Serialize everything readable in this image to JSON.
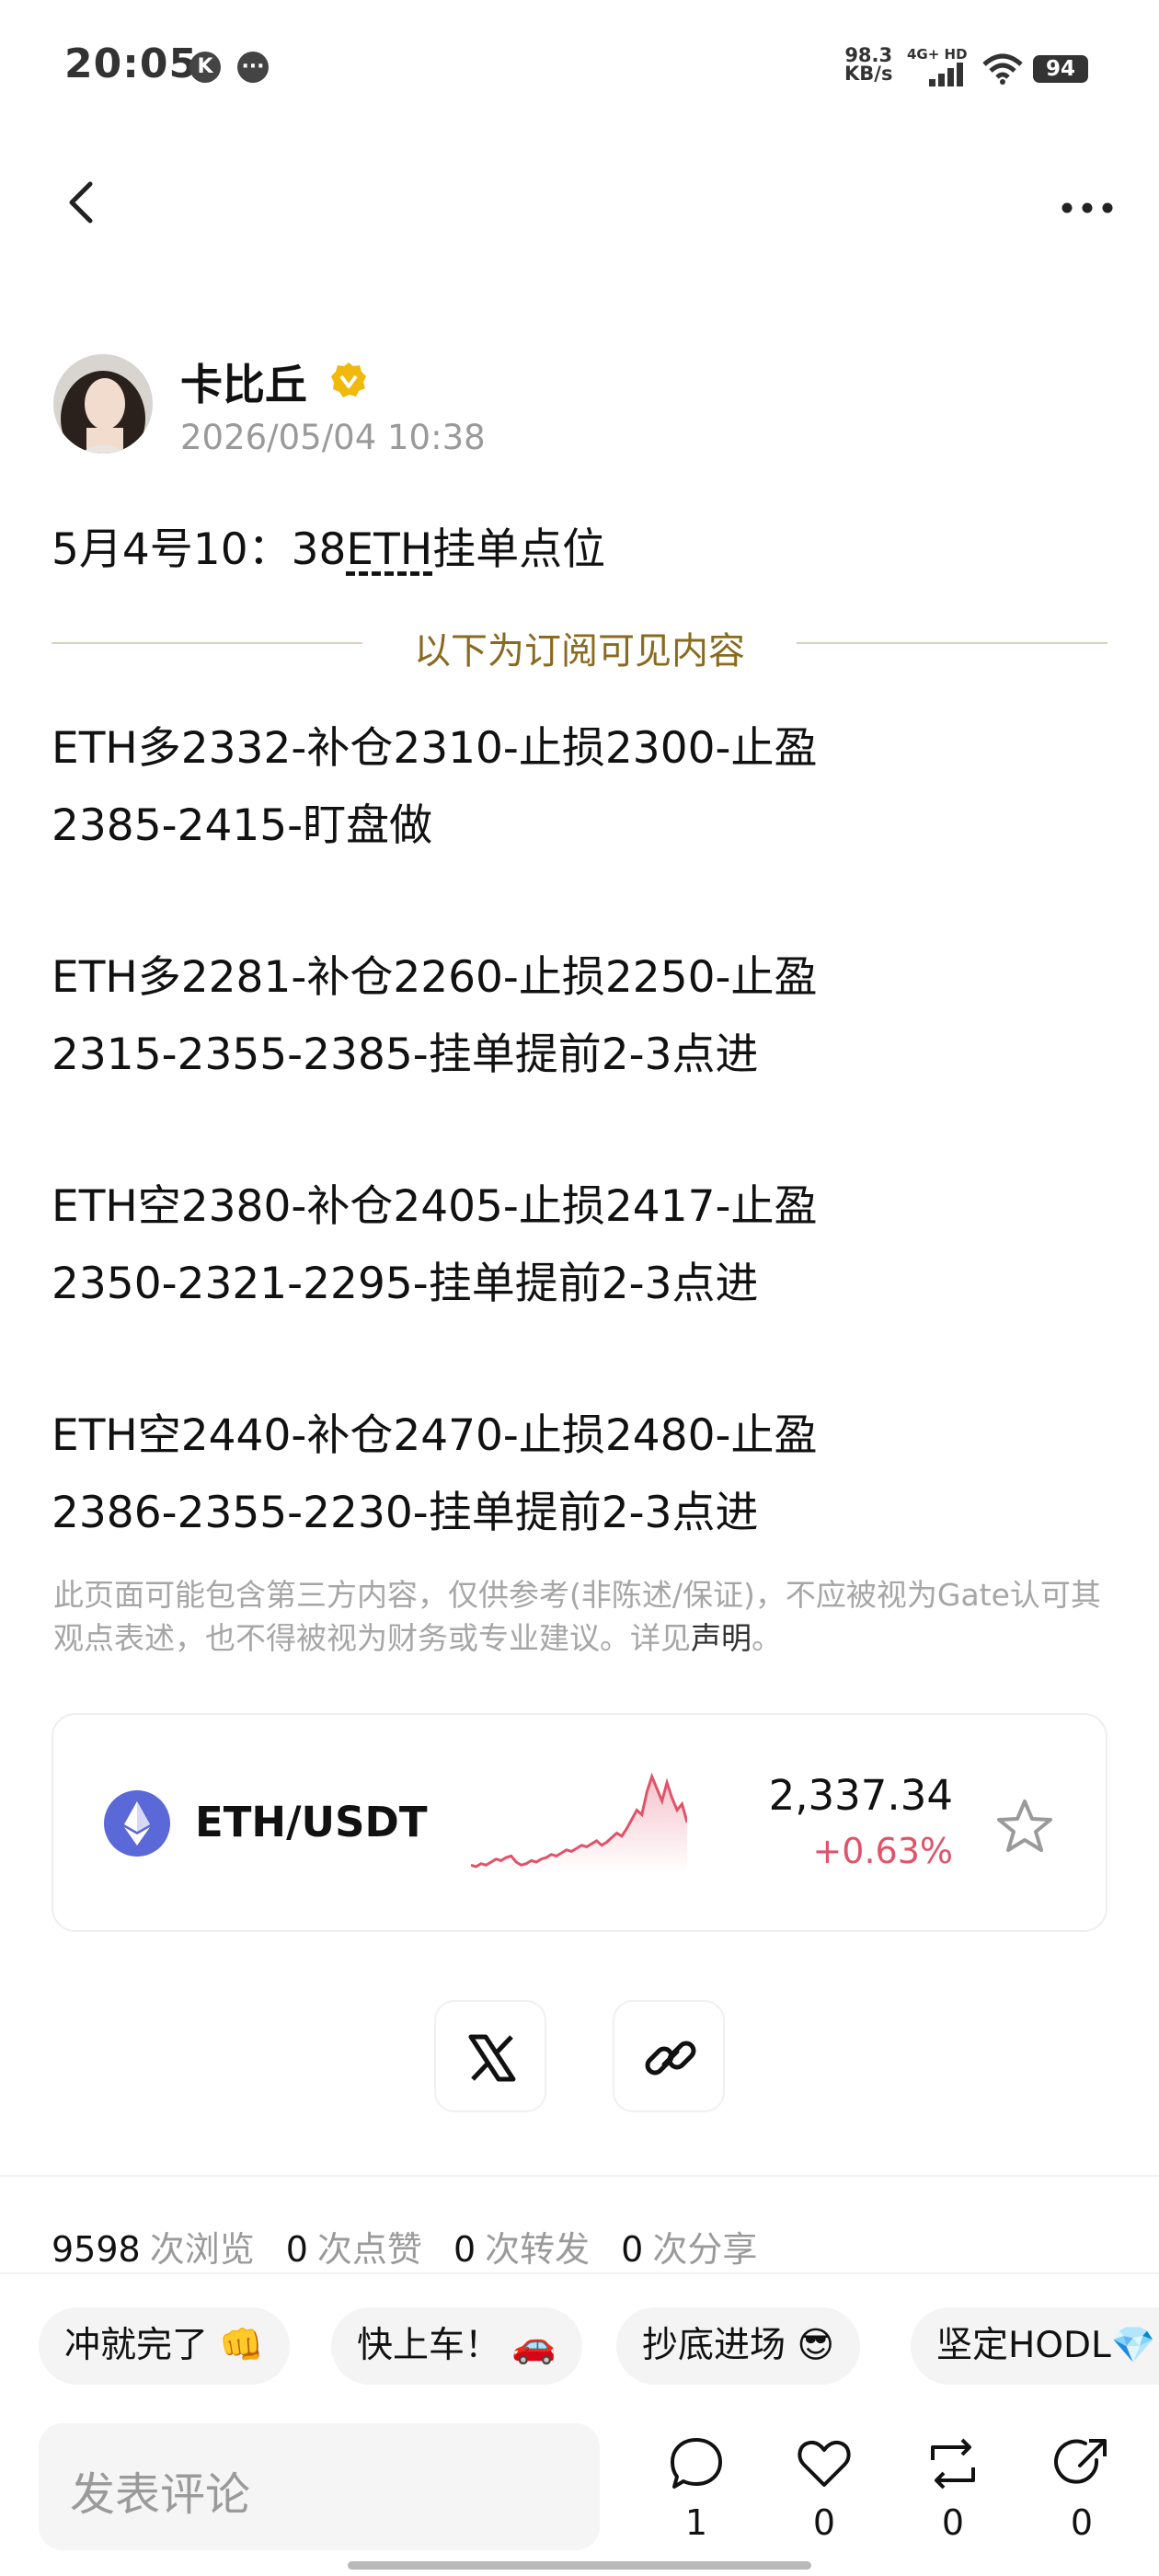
{
  "status_bar": {
    "time": "20:05",
    "speed_value": "98.3",
    "speed_unit": "KB/s",
    "network": "4G+ HD",
    "battery": "94"
  },
  "header": {
    "back_icon": "chevron-left-icon",
    "more_icon": "ellipsis-icon"
  },
  "post": {
    "author": "卡比丘",
    "date": "2026/05/04 10:38",
    "title_prefix": "5月4号10：38",
    "title_link": "ETH",
    "title_suffix": "挂单点位",
    "subscriber_label": "以下为订阅可见内容",
    "signals": [
      {
        "line1": "ETH多2332-补仓2310-止损2300-止盈",
        "line2": "2385-2415-盯盘做"
      },
      {
        "line1": "ETH多2281-补仓2260-止损2250-止盈",
        "line2": "2315-2355-2385-挂单提前2-3点进"
      },
      {
        "line1": "ETH空2380-补仓2405-止损2417-止盈",
        "line2": "2350-2321-2295-挂单提前2-3点进"
      },
      {
        "line1": "ETH空2440-补仓2470-止损2480-止盈",
        "line2": "2386-2355-2230-挂单提前2-3点进"
      }
    ],
    "disclaimer_text": "此页面可能包含第三方内容，仅供参考(非陈述/保证)，不应被视为Gate认可其观点表述，也不得被视为财务或专业建议。详见",
    "disclaimer_link": "声明",
    "disclaimer_end": "。"
  },
  "market": {
    "pair": "ETH/USDT",
    "price": "2,337.34",
    "change": "+0.63%",
    "accent_color": "#e0536a",
    "sparkline": [
      22,
      21,
      23,
      22,
      24,
      26,
      25,
      27,
      28,
      24,
      22,
      23,
      25,
      24,
      26,
      27,
      29,
      28,
      30,
      32,
      31,
      33,
      35,
      34,
      36,
      38,
      35,
      37,
      40,
      43,
      41,
      46,
      52,
      58,
      55,
      70,
      80,
      72,
      64,
      76,
      66,
      58,
      62,
      50
    ]
  },
  "share": {
    "x_icon": "x-logo-icon",
    "link_icon": "link-icon"
  },
  "stats": {
    "views": "9598",
    "views_label": "次浏览",
    "likes": "0",
    "likes_label": "次点赞",
    "reposts": "0",
    "reposts_label": "次转发",
    "shares": "0",
    "shares_label": "次分享"
  },
  "quick_replies": [
    "冲就完了 👊",
    "快上车！ 🚗",
    "抄底进场 😎",
    "坚定HODL💎"
  ],
  "bottom_bar": {
    "comment_placeholder": "发表评论",
    "comment_count": "1",
    "like_count": "0",
    "repost_count": "0",
    "share_count": "0"
  }
}
